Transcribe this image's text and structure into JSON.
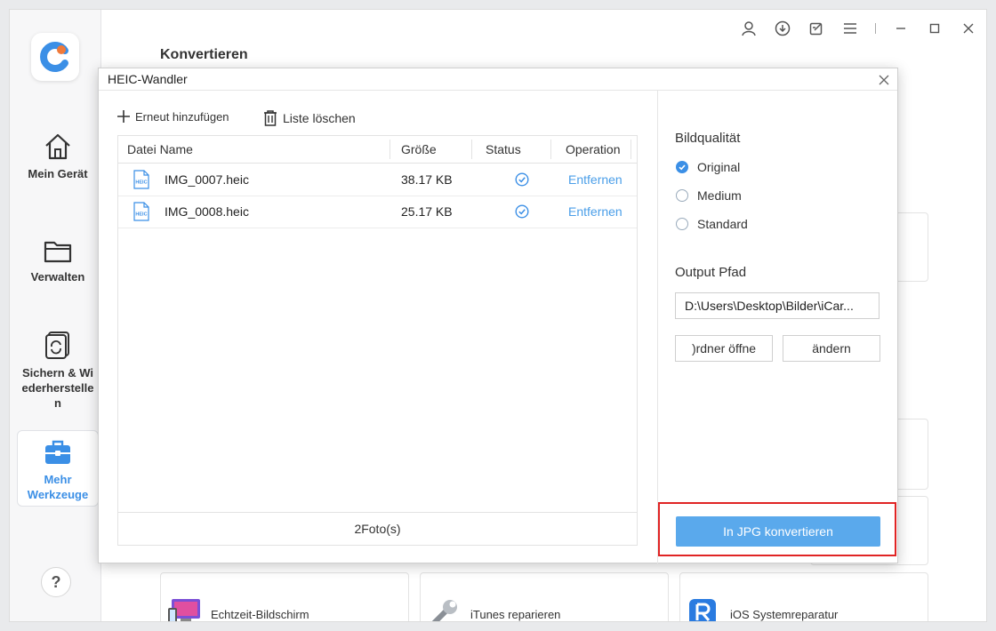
{
  "app": {
    "page_title": "Konvertieren",
    "accent_color": "#3b8fe6",
    "sidebar": {
      "items": [
        {
          "label": "Mein Gerät",
          "icon": "home-icon"
        },
        {
          "label": "Verwalten",
          "icon": "folder-icon"
        },
        {
          "label": "Sichern & Wiederherstellen",
          "icon": "backup-icon"
        },
        {
          "label": "Mehr Werkzeuge",
          "icon": "toolbox-icon",
          "active": true
        }
      ],
      "help_label": "?"
    },
    "tools": [
      {
        "label": "Echtzeit-Bildschirm",
        "icon": "screen-mirror-icon"
      },
      {
        "label": "iTunes reparieren",
        "icon": "wrench-icon"
      },
      {
        "label": "iOS Systemreparatur",
        "icon": "ios-repair-icon"
      }
    ]
  },
  "dialog": {
    "title": "HEIC-Wandler",
    "add_again": "Erneut hinzufügen",
    "clear_list": "Liste löschen",
    "table": {
      "columns": [
        "Datei Name",
        "Größe",
        "Status",
        "Operation"
      ],
      "rows": [
        {
          "file_type": "HEIC",
          "name": "IMG_0007.heic",
          "size": "38.17 KB",
          "status": "done",
          "operation": "Entfernen"
        },
        {
          "file_type": "HEIC",
          "name": "IMG_0008.heic",
          "size": "25.17 KB",
          "status": "done",
          "operation": "Entfernen"
        }
      ],
      "footer": "2Foto(s)"
    },
    "quality": {
      "label": "Bildqualität",
      "options": [
        "Original",
        "Medium",
        "Standard"
      ],
      "selected": "Original"
    },
    "output": {
      "label": "Output Pfad",
      "path": "D:\\Users\\Desktop\\Bilder\\iCar...",
      "open_folder": ")rdner öffne",
      "change": "ändern"
    },
    "convert_button": "In JPG konvertieren"
  }
}
